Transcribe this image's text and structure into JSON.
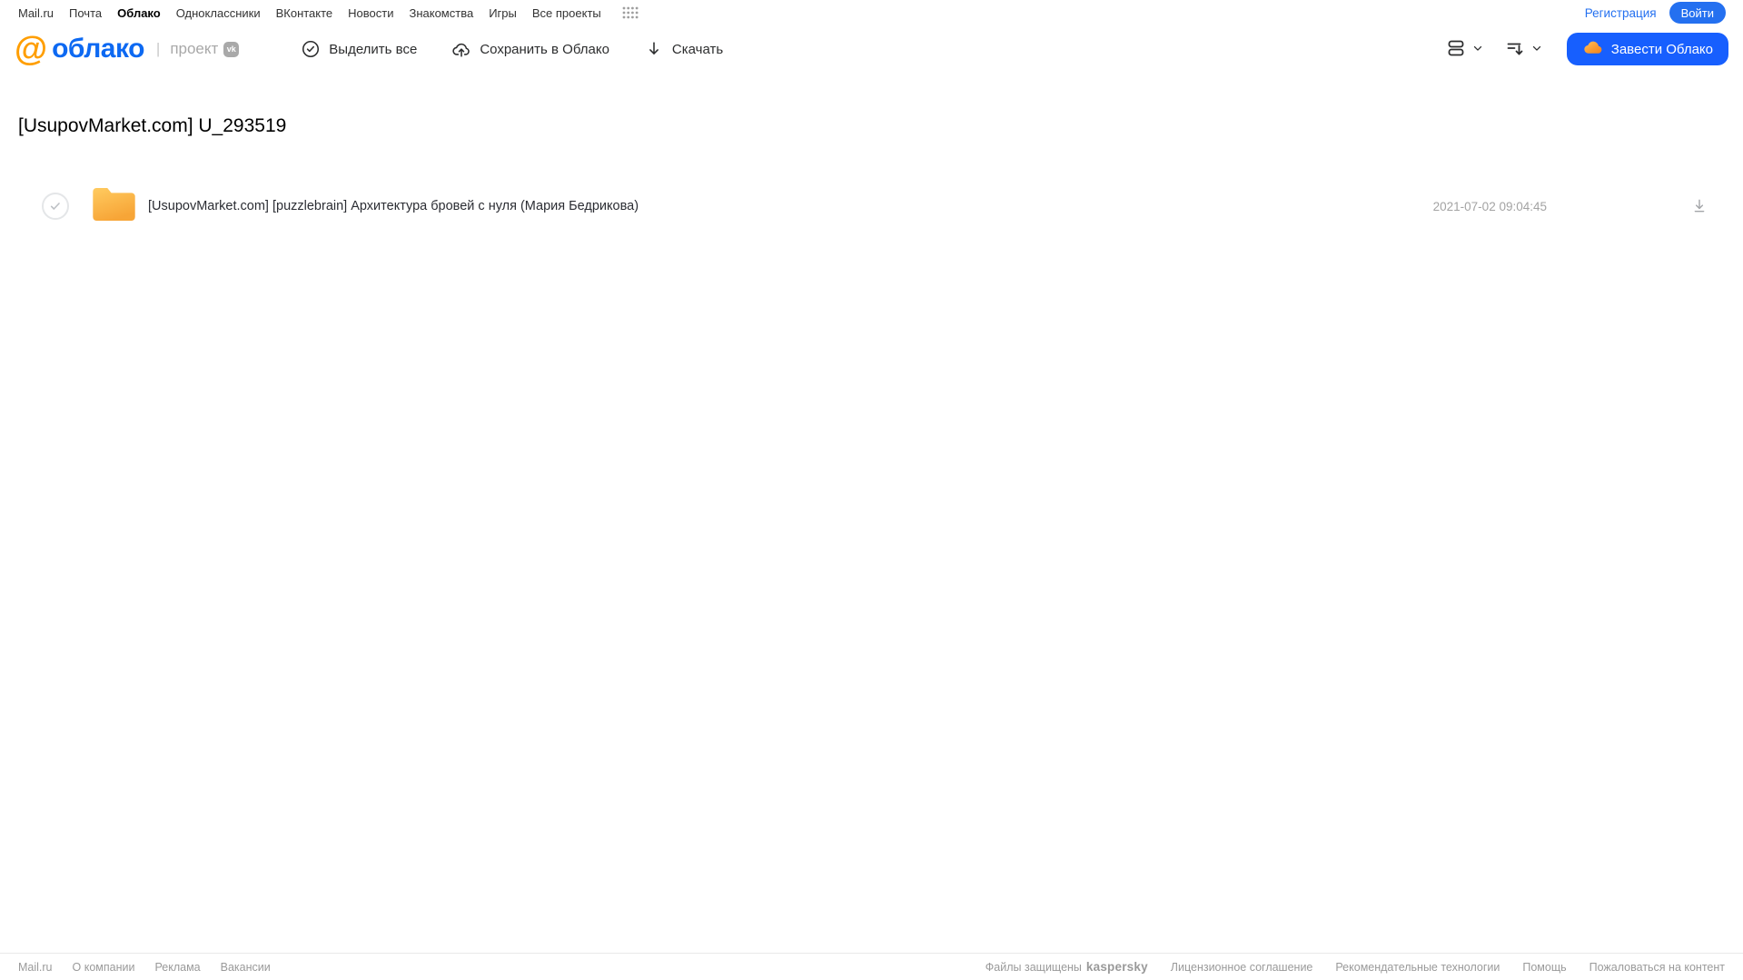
{
  "portal_nav": {
    "links": [
      {
        "label": "Mail.ru",
        "active": false
      },
      {
        "label": "Почта",
        "active": false
      },
      {
        "label": "Облако",
        "active": true
      },
      {
        "label": "Одноклассники",
        "active": false
      },
      {
        "label": "ВКонтакте",
        "active": false
      },
      {
        "label": "Новости",
        "active": false
      },
      {
        "label": "Знакомства",
        "active": false
      },
      {
        "label": "Игры",
        "active": false
      },
      {
        "label": "Все проекты",
        "active": false
      }
    ],
    "registration_label": "Регистрация",
    "login_label": "Войти"
  },
  "header": {
    "logo_at": "@",
    "logo_text": "облако",
    "logo_divider": "|",
    "project_label": "проект",
    "vk_badge": "vk",
    "toolbar": [
      {
        "label": "Выделить все",
        "icon": "check-circle-icon"
      },
      {
        "label": "Сохранить в Облако",
        "icon": "cloud-upload-icon"
      },
      {
        "label": "Скачать",
        "icon": "download-icon"
      }
    ],
    "view_controls": [
      "view-mode-toggle",
      "sort-toggle"
    ],
    "get_cloud_label": "Завести Облако"
  },
  "main": {
    "title": "[UsupovMarket.com] U_293519",
    "files": [
      {
        "type": "folder",
        "name": "[UsupovMarket.com] [puzzlebrain] Архитектура бровей с нуля (Мария Бедрикова)",
        "modified": "2021-07-02 09:04:45",
        "selected": false
      }
    ]
  },
  "footer": {
    "left_links": [
      "Mail.ru",
      "О компании",
      "Реклама",
      "Вакансии"
    ],
    "protected_text": "Файлы защищены",
    "protected_brand": "kaspersky",
    "right_links": [
      "Лицензионное соглашение",
      "Рекомендательные технологии",
      "Помощь",
      "Пожаловаться на контент"
    ]
  },
  "colors": {
    "accent_blue": "#175ffe",
    "login_blue": "#2470f0",
    "logo_orange": "#ff9e00",
    "logo_blue": "#0d69f2",
    "kaspersky_green": "#00a88e",
    "folder_top": "#ffcb60",
    "folder_bottom": "#f7a537",
    "muted_gray": "#a3a3a3"
  }
}
